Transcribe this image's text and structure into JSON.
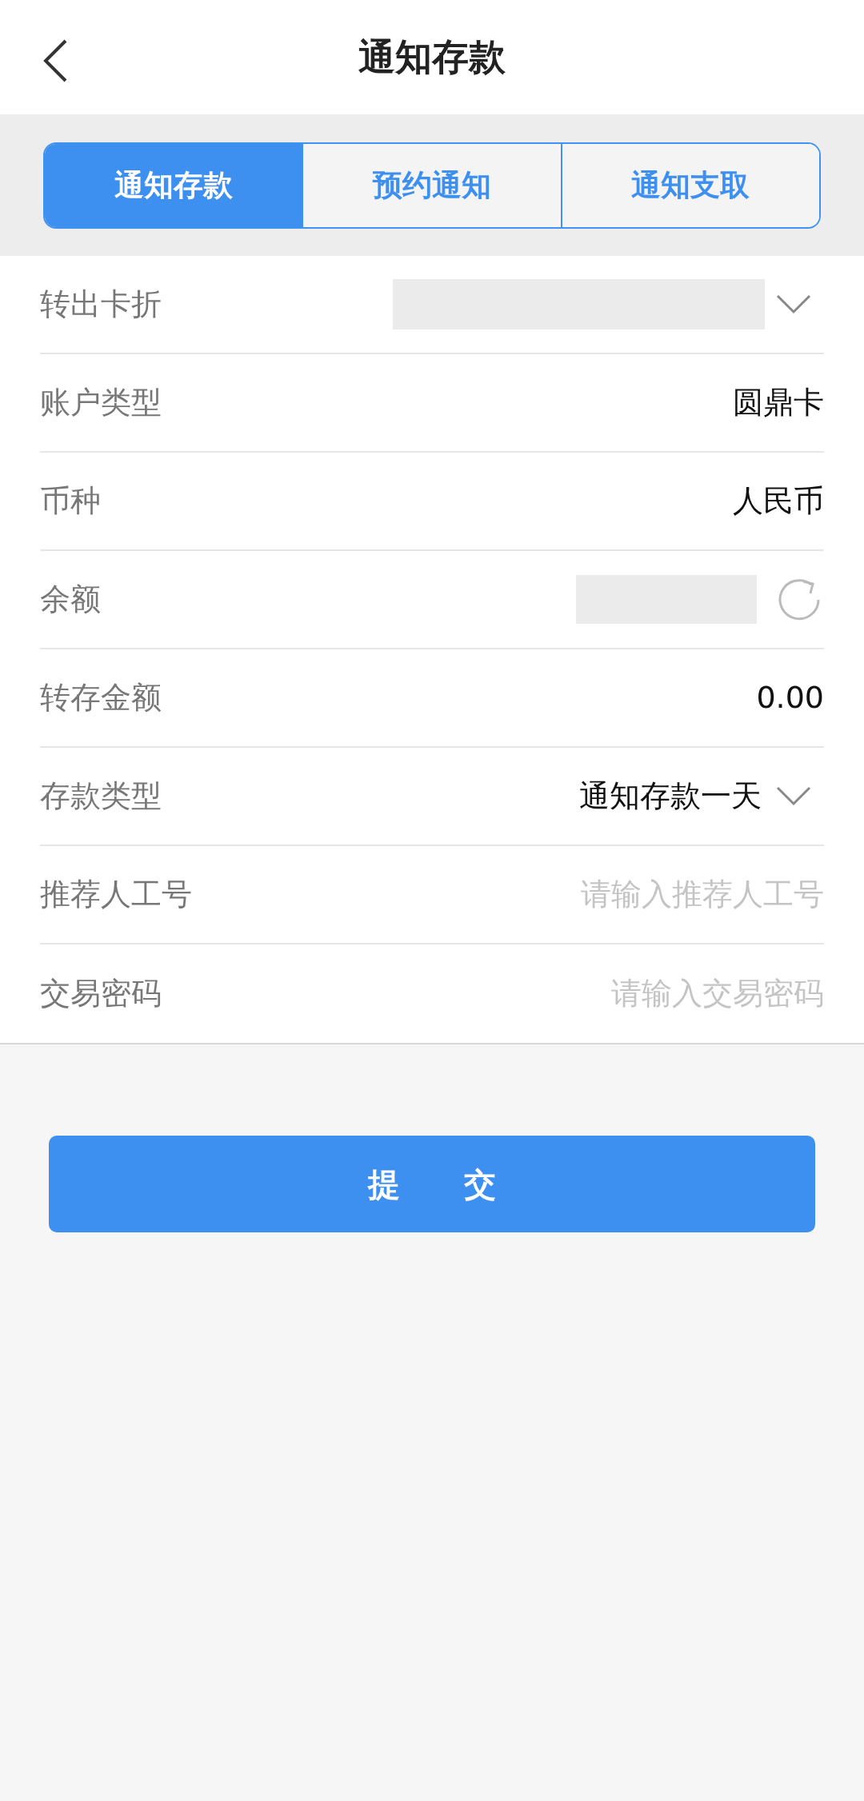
{
  "header": {
    "title": "通知存款"
  },
  "tabs": [
    {
      "label": "通知存款",
      "selected": true
    },
    {
      "label": "预约通知",
      "selected": false
    },
    {
      "label": "通知支取",
      "selected": false
    }
  ],
  "fields": [
    {
      "kind": "select",
      "label": "转出卡折"
    },
    {
      "kind": "text",
      "label": "账户类型",
      "value": "圆鼎卡"
    },
    {
      "kind": "text",
      "label": "币种",
      "value": "人民币"
    },
    {
      "kind": "refresh",
      "label": "余额"
    },
    {
      "kind": "text",
      "label": "转存金额",
      "value": "0.00"
    },
    {
      "kind": "select",
      "label": "存款类型",
      "value": "通知存款一天"
    },
    {
      "kind": "input",
      "label": "推荐人工号",
      "placeholder": "请输入推荐人工号"
    },
    {
      "kind": "input",
      "label": "交易密码",
      "placeholder": "请输入交易密码"
    }
  ],
  "submit": {
    "label": "提交"
  }
}
